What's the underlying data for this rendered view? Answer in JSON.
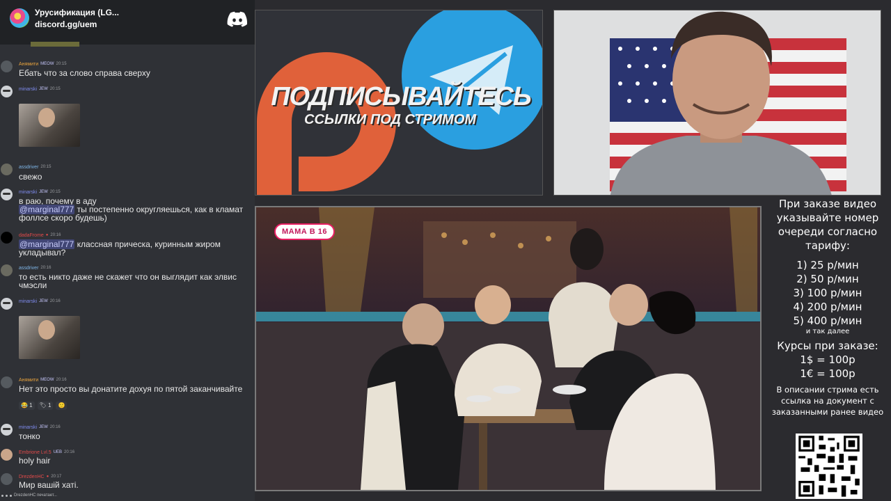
{
  "chat": {
    "server_name": "Урусификация (LG...",
    "server_invite": "discord.gg/uem",
    "messages": [
      {
        "user": "Анямити",
        "user_color": "#e8a33d",
        "badge": "MEOW",
        "time": "20:15",
        "text": "Ебать что за слово справа сверху"
      },
      {
        "user": "minarski",
        "user_color": "#7f8cf0",
        "badge": "JEW",
        "time": "20:15",
        "image": true
      },
      {
        "user": "assdriver",
        "user_color": "#7fb6e8",
        "badge": "",
        "time": "20:15",
        "text": "свежо"
      },
      {
        "user": "minarski",
        "user_color": "#7f8cf0",
        "badge": "JEW",
        "time": "20:15",
        "text_line1": "в раю, почему в аду",
        "mention": "@marginal777",
        "text_rest": " ты постепенно округляешься, как в кламат фоллсе скоро будешь)"
      },
      {
        "user": "dadaFrome",
        "user_color": "#e24a4a",
        "badge": "",
        "time": "20:16",
        "mention": "@marginal777",
        "text_rest": " классная прическа, куринным жиром укладывал?"
      },
      {
        "user": "assdriver",
        "user_color": "#7fb6e8",
        "badge": "",
        "time": "20:16",
        "text": "то есть никто даже не скажет что он выглядит как элвис чмэсли"
      },
      {
        "user": "minarski",
        "user_color": "#7f8cf0",
        "badge": "JEW",
        "time": "20:16",
        "image": true
      },
      {
        "user": "Анямити",
        "user_color": "#e8a33d",
        "badge": "MEOW",
        "time": "20:16",
        "text": "Нет это просто вы донатите дохуя по пятой заканчивайте",
        "reactions": [
          "😂 1",
          "🏷 1",
          "🙂"
        ]
      },
      {
        "user": "minarski",
        "user_color": "#7f8cf0",
        "badge": "JEW",
        "time": "20:16",
        "text": "тонко"
      },
      {
        "user": "Embrione Lvl.5",
        "user_color": "#e24a4a",
        "badge": "UEB",
        "time": "20:16",
        "text": "holy hair"
      },
      {
        "user": "DrezdenHC",
        "user_color": "#e24a4a",
        "badge": "",
        "time": "20:17",
        "text": "Мир вашій хаті."
      }
    ],
    "typing": "DrezdenHC печатает..."
  },
  "promo": {
    "title": "ПОДПИСЫВАЙТЕСЬ",
    "subtitle": "ССЫЛКИ ПОД СТРИМОМ",
    "patreon_color": "#e0613a",
    "telegram_color": "#2a9fe0"
  },
  "show": {
    "logo": "МАМА В 16"
  },
  "info": {
    "heading": "При заказе видео указывайте номер очереди согласно тарифу:",
    "tariffs": [
      "1) 25 р/мин",
      "2) 50 р/мин",
      "3) 100 р/мин",
      "4) 200 р/мин",
      "5) 400 р/мин"
    ],
    "and_so_on": "и так далее",
    "rates_title": "Курсы при заказе:",
    "rates": [
      "1$ = 100р",
      "1€ = 100р"
    ],
    "description_note": "В описании стрима есть ссылка на документ с заказанными ранее видео"
  }
}
